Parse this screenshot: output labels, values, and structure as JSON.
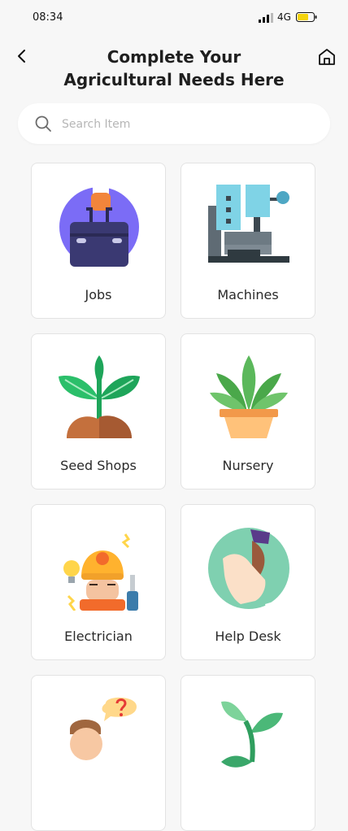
{
  "status": {
    "time": "08:34",
    "network": "4G",
    "colors": {
      "battery": "#f4d40c"
    }
  },
  "header": {
    "title": "Complete Your Agricultural Needs Here",
    "back_icon": "chevron-left-icon",
    "home_icon": "home-icon"
  },
  "search": {
    "placeholder": "Search Item",
    "value": "",
    "icon": "search-icon"
  },
  "categories": [
    {
      "label": "Jobs",
      "icon": "briefcase-icon"
    },
    {
      "label": "Machines",
      "icon": "drill-machine-icon"
    },
    {
      "label": "Seed Shops",
      "icon": "sprout-icon"
    },
    {
      "label": "Nursery",
      "icon": "potted-plant-icon"
    },
    {
      "label": "Electrician",
      "icon": "electrician-icon"
    },
    {
      "label": "Help Desk",
      "icon": "handshake-icon"
    },
    {
      "label": "",
      "icon": "question-person-icon"
    },
    {
      "label": "",
      "icon": "plant-icon"
    }
  ]
}
